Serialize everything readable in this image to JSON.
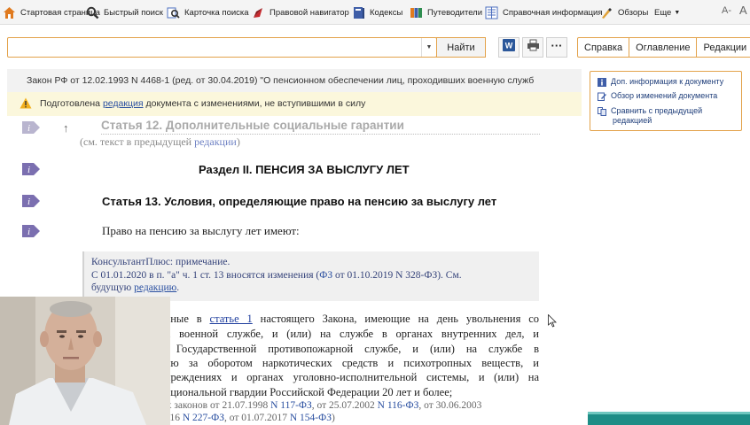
{
  "toolbar": {
    "items": [
      {
        "label": "Стартовая страница",
        "icon": "home-icon"
      },
      {
        "label": "Быстрый поиск",
        "icon": "search-icon"
      },
      {
        "label": "Карточка поиска",
        "icon": "search-card-icon"
      },
      {
        "label": "Правовой навигатор",
        "icon": "navigator-icon"
      },
      {
        "label": "Кодексы",
        "icon": "codex-icon"
      },
      {
        "label": "Путеводители",
        "icon": "guides-icon"
      },
      {
        "label": "Справочная информация",
        "icon": "reference-icon"
      },
      {
        "label": "Обзоры",
        "icon": "reviews-icon"
      }
    ],
    "more_label": "Еще",
    "font_decrease": "A-",
    "font_increase": "A"
  },
  "search": {
    "value": "",
    "placeholder": "",
    "find_label": "Найти"
  },
  "tabs": [
    "Справка",
    "Оглавление",
    "Редакции"
  ],
  "document": {
    "title": "Закон РФ от 12.02.1993 N 4468-1 (ред. от 30.04.2019) \"О пенсионном обеспечении лиц, проходивших военную служб",
    "warning_prefix": "Подготовлена",
    "warning_link": "редакция",
    "warning_suffix": "документа с изменениями, не вступившими в силу",
    "faded_heading": "Статья 12. Дополнительные социальные гарантии",
    "faded_sub_text": "(см. текст в предыдущей",
    "faded_sub_link": "редакции",
    "faded_sub_close": ")",
    "section_heading": "Раздел II. ПЕНСИЯ ЗА ВЫСЛУГУ ЛЕТ",
    "article_heading": "Статья 13. Условия, определяющие право на пенсию за выслугу лет",
    "para1": "Право на пенсию за выслугу лет имеют:",
    "note": {
      "title": "КонсультантПлюс: примечание.",
      "line2_a": "С 01.01.2020 в п. \"а\" ч. 1 ст. 13 вносятся изменения (",
      "line2_link": "ФЗ",
      "line2_b": " от 01.10.2019 N 328-ФЗ). См.",
      "line3_a": "будущую ",
      "line3_link": "редакцию",
      "line3_b": "."
    },
    "body_lines": {
      "l1_a": "анные в",
      "l1_link": "статье 1",
      "l1_b": "настоящего Закона, имеющие на день увольнения со",
      "l2": "на военной службе, и (или) на службе в органах внутренних дел, и",
      "l3": "в Государственной противопожарной службе, и (или) на службе в",
      "l4": "олю за оборотом наркотических средств и психотропных веществ, и",
      "l5": "учреждениях и органах уголовно-исполнительной системы, и (или) на",
      "l6": "национальной гвардии Российской Федерации 20 лет и более;"
    },
    "small_lines": {
      "s1_a": "ых законов от 21.07.1998",
      "s1_l1": "N 117-ФЗ",
      "s1_b": ", от 25.07.2002",
      "s1_l2": "N 116-ФЗ",
      "s1_c": ", от 30.06.2003",
      "s2_a": "2016",
      "s2_l1": "N 227-ФЗ",
      "s2_b": ", от 01.07.2017",
      "s2_l2": "N 154-ФЗ",
      "s2_c": ")"
    }
  },
  "right_panel": {
    "items": [
      {
        "label": "Доп. информация к документу",
        "icon": "info-icon"
      },
      {
        "label": "Обзор изменений документа",
        "icon": "edit-icon"
      },
      {
        "label": "Сравнить с предыдущей",
        "label2": "редакцией",
        "icon": "compare-icon"
      }
    ]
  },
  "colors": {
    "accent": "#e3a24a",
    "link": "#2a4fa0",
    "gutter_icon": "#7b6fb0",
    "warning_bg": "#fbf7dc"
  }
}
